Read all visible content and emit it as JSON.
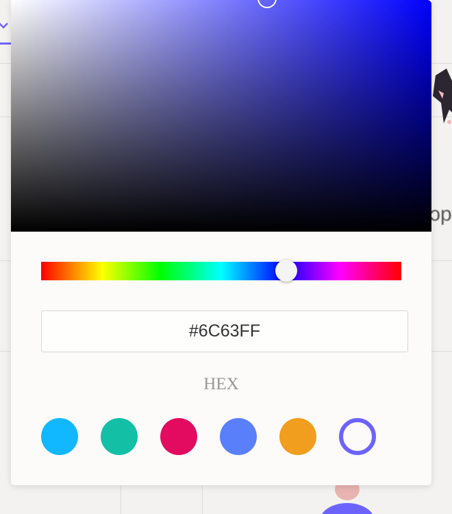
{
  "background_page": {
    "visible_text_fragment": "ɔpt",
    "accent_color": "#6C63FF"
  },
  "color_picker": {
    "selected_hex": "#6C63FF",
    "base_hue_color": "#0000ff",
    "hue_position_fraction": 0.68,
    "saturation_brightness_cursor_color": "#0000ff",
    "format_label": "HEX",
    "preset_swatches": [
      {
        "name": "sky-blue",
        "color": "#12b8ff",
        "style": "filled"
      },
      {
        "name": "teal",
        "color": "#13c0a5",
        "style": "filled"
      },
      {
        "name": "crimson",
        "color": "#e20b60",
        "style": "filled"
      },
      {
        "name": "cornflower-blue",
        "color": "#5a7ffb",
        "style": "filled"
      },
      {
        "name": "orange",
        "color": "#f19d1d",
        "style": "filled"
      },
      {
        "name": "violet",
        "color": "#6c63ff",
        "style": "outline"
      }
    ]
  }
}
